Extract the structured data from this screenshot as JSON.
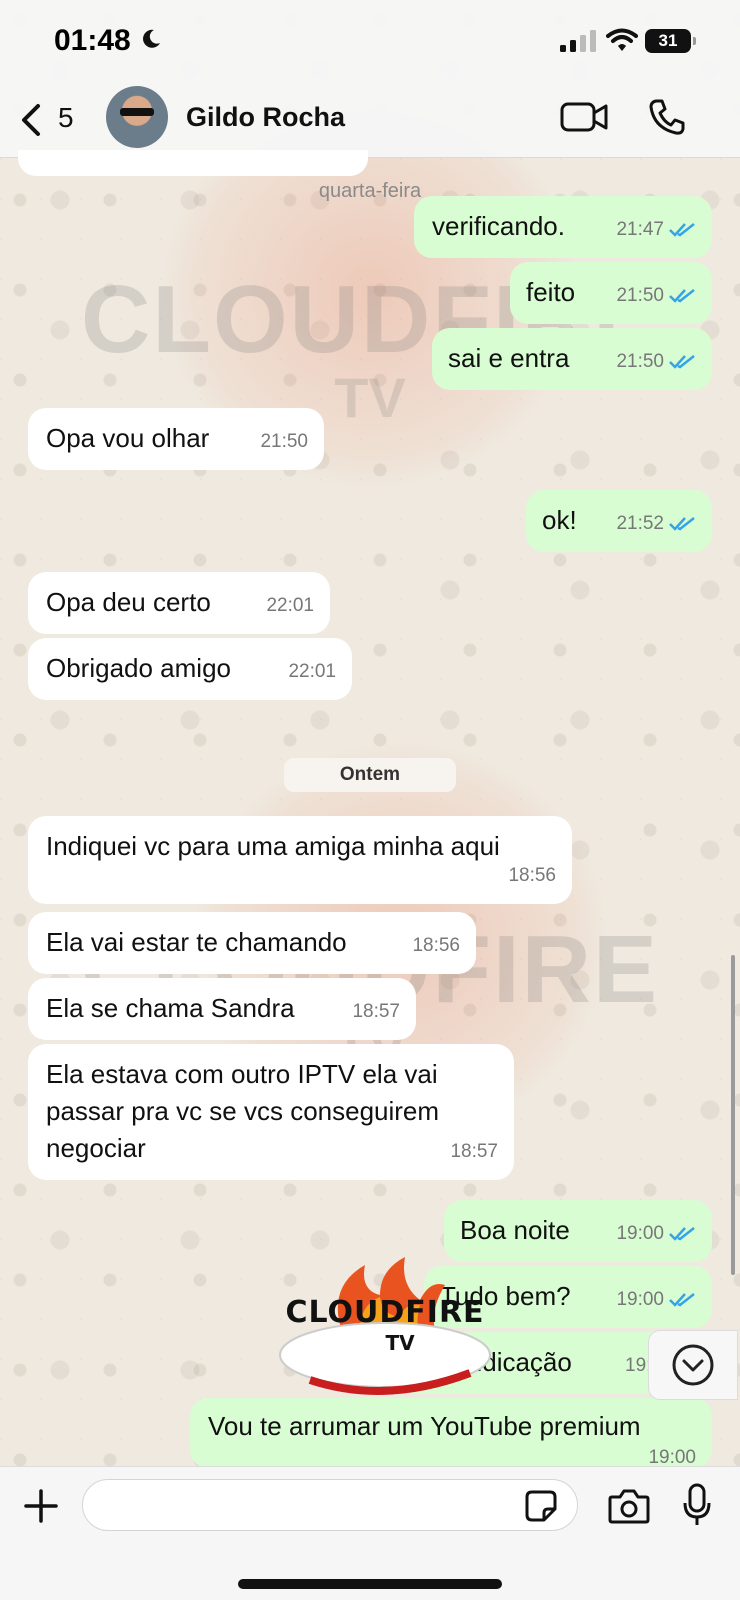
{
  "status_bar": {
    "time": "01:48",
    "battery": "31"
  },
  "header": {
    "back_count": "5",
    "contact_name": "Gildo Rocha"
  },
  "day_labels": {
    "wednesday": "quarta-feira",
    "yesterday": "Ontem"
  },
  "messages": [
    {
      "text": "verificando.",
      "time": "21:47",
      "direction": "out"
    },
    {
      "text": "feito",
      "time": "21:50",
      "direction": "out"
    },
    {
      "text": "sai e entra",
      "time": "21:50",
      "direction": "out"
    },
    {
      "text": "Opa vou olhar",
      "time": "21:50",
      "direction": "in"
    },
    {
      "text": "ok!",
      "time": "21:52",
      "direction": "out"
    },
    {
      "text": "Opa deu certo",
      "time": "22:01",
      "direction": "in"
    },
    {
      "text": "Obrigado amigo",
      "time": "22:01",
      "direction": "in"
    },
    {
      "text": "Indiquei vc para uma amiga minha aqui",
      "time": "18:56",
      "direction": "in"
    },
    {
      "text": "Ela vai estar te chamando",
      "time": "18:56",
      "direction": "in"
    },
    {
      "text": "Ela se chama Sandra",
      "time": "18:57",
      "direction": "in"
    },
    {
      "text": "Ela estava com outro IPTV ela vai passar pra vc se vcs conseguirem negociar",
      "time": "18:57",
      "direction": "in"
    },
    {
      "text": "Boa noite",
      "time": "19:00",
      "direction": "out"
    },
    {
      "text": "Tudo bem?",
      "time": "19:00",
      "direction": "out"
    },
    {
      "text": "indicação",
      "time": "19:0",
      "direction": "out"
    },
    {
      "text": "Vou te arrumar um YouTube premium",
      "time": "19:00",
      "direction": "out"
    }
  ],
  "watermark": {
    "brand": "CLOUDFIRE",
    "sub": "TV"
  },
  "composer": {
    "placeholder": ""
  },
  "colors": {
    "outgoing_bubble": "#d9fdd3",
    "incoming_bubble": "#ffffff",
    "read_ticks": "#34a4e8"
  }
}
